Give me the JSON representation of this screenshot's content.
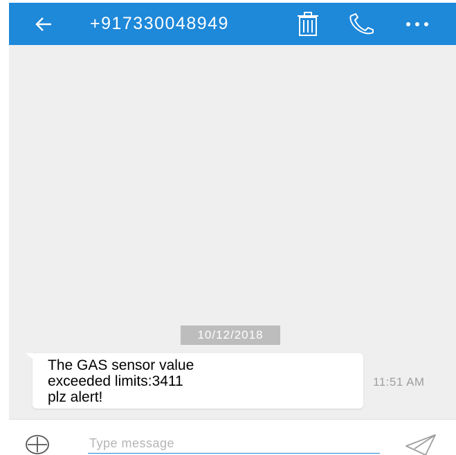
{
  "header": {
    "contact": "+917330048949",
    "bar_color": "#1e88d9"
  },
  "icons": {
    "back": "back-arrow-icon",
    "delete": "trash-icon",
    "call": "phone-icon",
    "more": "more-dots-icon",
    "add": "add-circle-icon",
    "send": "send-icon"
  },
  "conversation": {
    "date": "10/12/2018",
    "messages": [
      {
        "text": "The GAS sensor value\nexceeded limits:3411\nplz alert!",
        "time": "11:51 AM",
        "direction": "incoming"
      }
    ]
  },
  "composer": {
    "placeholder": "Type message",
    "value": ""
  }
}
